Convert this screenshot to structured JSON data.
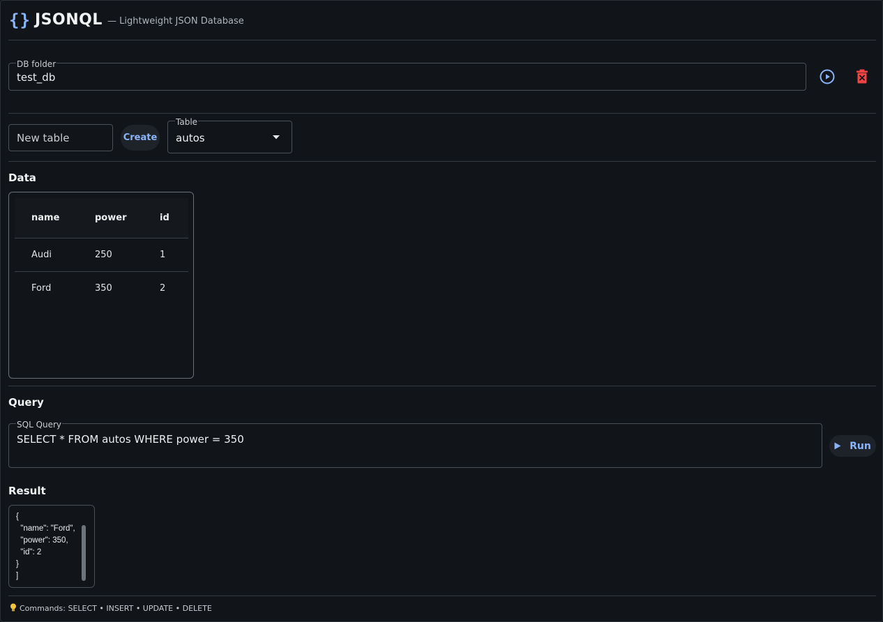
{
  "header": {
    "logo_glyph": "{}",
    "title": "JSONQL",
    "subtitle": "— Lightweight JSON Database"
  },
  "db": {
    "label": "DB folder",
    "value": "test_db",
    "open_icon": "play-circle-icon",
    "delete_icon": "trash-icon",
    "accent": "#8ab4f8",
    "danger": "#ef4444"
  },
  "table_controls": {
    "new_table_placeholder": "New table",
    "create_label": "Create",
    "select_label": "Table",
    "selected_table": "autos"
  },
  "data": {
    "title": "Data",
    "columns": [
      "name",
      "power",
      "id"
    ],
    "rows": [
      [
        "Audi",
        "250",
        "1"
      ],
      [
        "Ford",
        "350",
        "2"
      ]
    ]
  },
  "query": {
    "title": "Query",
    "label": "SQL Query",
    "value": "SELECT * FROM autos WHERE power = 350",
    "run_label": "Run"
  },
  "result": {
    "title": "Result",
    "text": "{\n  \"name\": \"Ford\",\n  \"power\": 350,\n  \"id\": 2\n}\n]"
  },
  "footer": {
    "icon": "lightbulb-icon",
    "text": "Commands: SELECT • INSERT • UPDATE • DELETE"
  }
}
